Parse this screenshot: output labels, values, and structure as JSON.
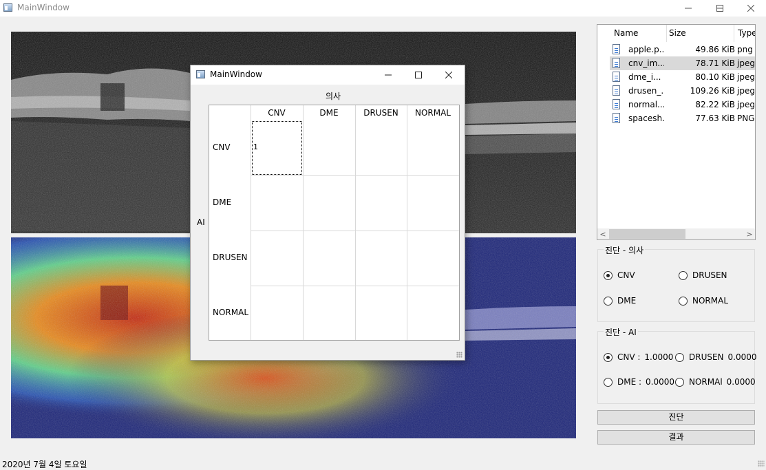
{
  "window": {
    "title": "MainWindow",
    "minimize_icon": "minimize-icon",
    "maximize_icon": "maximize-icon",
    "close_icon": "close-icon"
  },
  "file_view": {
    "columns": [
      "Name",
      "Size",
      "Type"
    ],
    "rows": [
      {
        "name": "apple.p...",
        "size": "49.86 KiB",
        "type": "png",
        "selected": false
      },
      {
        "name": "cnv_im...",
        "size": "78.71 KiB",
        "type": "jpeg",
        "selected": true
      },
      {
        "name": "dme_i...",
        "size": "80.10 KiB",
        "type": "jpeg",
        "selected": false
      },
      {
        "name": "drusen_...",
        "size": "109.26 KiB",
        "type": "jpeg",
        "selected": false
      },
      {
        "name": "normal...",
        "size": "82.22 KiB",
        "type": "jpeg",
        "selected": false
      },
      {
        "name": "spacesh...",
        "size": "77.63 KiB",
        "type": "PNG",
        "selected": false
      }
    ],
    "scroll_left_icon": "<",
    "scroll_right_icon": ">"
  },
  "doctor_group": {
    "title": "진단 - 의사",
    "options": [
      {
        "label": "CNV",
        "checked": true
      },
      {
        "label": "DRUSEN",
        "checked": false
      },
      {
        "label": "DME",
        "checked": false
      },
      {
        "label": "NORMAL",
        "checked": false
      }
    ]
  },
  "ai_group": {
    "title": "진단 - AI",
    "options": [
      {
        "label": "CNV :",
        "value": "1.0000",
        "checked": true
      },
      {
        "label": "DRUSEN",
        "value": "0.0000",
        "checked": false
      },
      {
        "label": "DME :",
        "value": "0.0000",
        "checked": false
      },
      {
        "label": "NORMAl",
        "value": "0.0000",
        "checked": false
      }
    ]
  },
  "buttons": {
    "diagnose": "진단",
    "result": "결과"
  },
  "status_bar": {
    "date": "2020년 7월 4일 토요일"
  },
  "dialog": {
    "title": "MainWindow",
    "doctor_axis_label": "의사",
    "ai_axis_label": "AI",
    "columns": [
      "CNV",
      "DME",
      "DRUSEN",
      "NORMAL"
    ],
    "rows": [
      "CNV",
      "DME",
      "DRUSEN",
      "NORMAL"
    ],
    "cells": [
      [
        "1",
        "",
        "",
        ""
      ],
      [
        "",
        "",
        "",
        ""
      ],
      [
        "",
        "",
        "",
        ""
      ],
      [
        "",
        "",
        "",
        ""
      ]
    ]
  },
  "colors": {
    "background": "#f0f0f0",
    "selection": "#d9d9d9",
    "heatmap_base": "#1b2478"
  }
}
